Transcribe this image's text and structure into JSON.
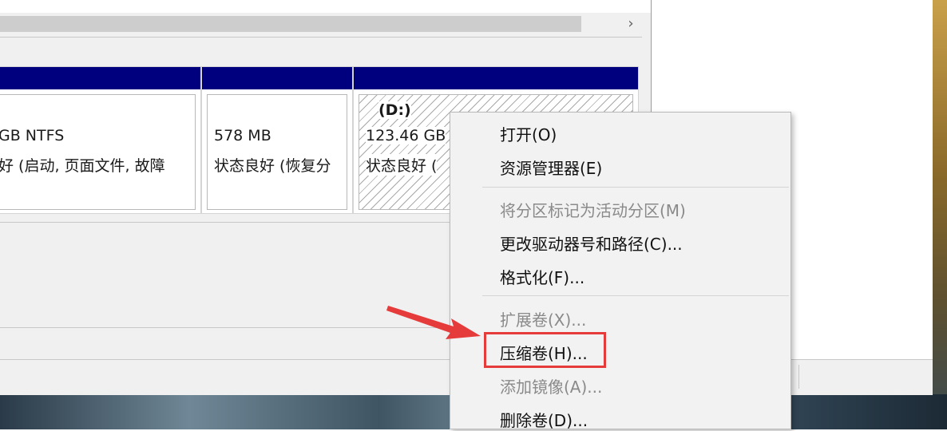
{
  "colors": {
    "volume_band": "#00007f",
    "highlight": "#e53b3b",
    "arrow": "#e53b3b"
  },
  "hscroll": {
    "right_arrow_icon": "chevron-right-icon",
    "right_arrow_glyph": "›"
  },
  "partitions": [
    {
      "size": "GB NTFS",
      "status": "好 (启动, 页面文件, 故障"
    },
    {
      "size": "578 MB",
      "status": "状态良好 (恢复分"
    },
    {
      "label": "(D:)",
      "size": "123.46 GB",
      "status": "状态良好 ("
    }
  ],
  "context_menu": {
    "items": [
      {
        "label": "打开(O)",
        "enabled": true
      },
      {
        "label": "资源管理器(E)",
        "enabled": true
      },
      {
        "label": "将分区标记为活动分区(M)",
        "enabled": false
      },
      {
        "label": "更改驱动器号和路径(C)...",
        "enabled": true
      },
      {
        "label": "格式化(F)...",
        "enabled": true
      },
      {
        "label": "扩展卷(X)...",
        "enabled": false
      },
      {
        "label": "压缩卷(H)...",
        "enabled": true,
        "highlighted": true
      },
      {
        "label": "添加镜像(A)...",
        "enabled": false
      },
      {
        "label": "删除卷(D)...",
        "enabled": true
      }
    ]
  }
}
